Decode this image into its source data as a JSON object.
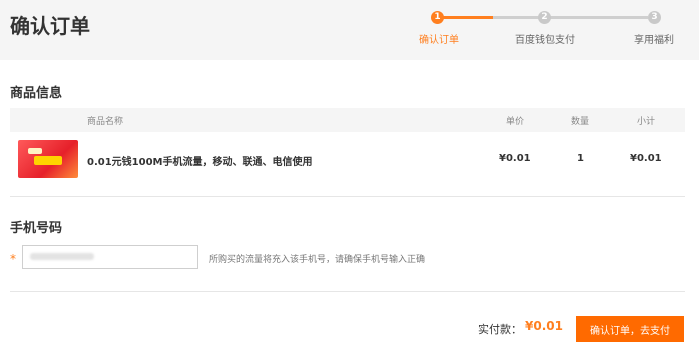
{
  "header": {
    "title": "确认订单"
  },
  "steps": [
    {
      "num": "1",
      "label": "确认订单",
      "active": true
    },
    {
      "num": "2",
      "label": "百度钱包支付",
      "active": false
    },
    {
      "num": "3",
      "label": "享用福利",
      "active": false
    }
  ],
  "product_section": {
    "title": "商品信息",
    "columns": {
      "name": "商品名称",
      "price": "单价",
      "qty": "数量",
      "subtotal": "小计"
    },
    "item": {
      "name": "0.01元钱100M手机流量，移动、联通、电信使用",
      "price": "¥0.01",
      "qty": "1",
      "subtotal": "¥0.01"
    }
  },
  "phone_section": {
    "title": "手机号码",
    "required_mark": "*",
    "hint": "所购买的流量将充入该手机号，请确保手机号输入正确"
  },
  "footer": {
    "total_label": "实付款：",
    "total_value": "¥0.01",
    "pay_button": "确认订单，去支付"
  },
  "colors": {
    "accent": "#ff7f1f",
    "button": "#ff6a00",
    "inactive_step": "#c9c9c9"
  }
}
